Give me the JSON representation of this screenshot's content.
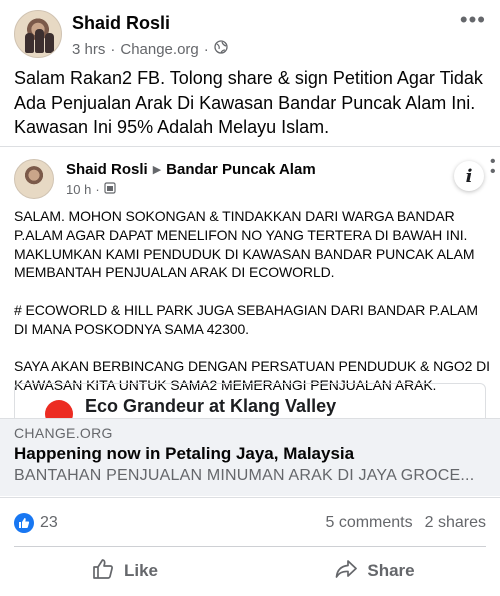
{
  "post": {
    "author": "Shaid Rosli",
    "time": "3 hrs",
    "source": "Change.org",
    "text": "Salam Rakan2 FB. Tolong share & sign Petition Agar Tidak Ada Penjualan Arak Di Kawasan Bandar Puncak Alam Ini. Kawasan Ini 95% Adalah Melayu Islam."
  },
  "shared_post": {
    "author": "Shaid Rosli",
    "target": "Bandar Puncak Alam",
    "time": "10 h",
    "paragraphs": [
      "SALAM. MOHON SOKONGAN & TINDAKKAN DARI WARGA BANDAR P.ALAM AGAR DAPAT MENELIFON NO YANG TERTERA DI BAWAH INI. MAKLUMKAN KAMI PENDUDUK DI KAWASAN BANDAR PUNCAK ALAM MEMBANTAH PENJUALAN ARAK DI ECOWORLD.",
      "# ECOWORLD & HILL PARK JUGA SEBAHAGIAN DARI BANDAR P.ALAM DI MANA POSKODNYA SAMA 42300.",
      "SAYA AKAN BERBINCANG DENGAN PERSATUAN PENDUDUK & NGO2 DI KAWASAN KITA UNTUK SAMA2 MEMERANGI PENJUALAN ARAK."
    ],
    "peek_title": "Eco Grandeur at Klang Valley"
  },
  "link_preview": {
    "domain": "CHANGE.ORG",
    "title": "Happening now in Petaling Jaya, Malaysia",
    "description": "BANTAHAN PENJUALAN MINUMAN ARAK DI JAYA GROCE..."
  },
  "stats": {
    "likes": "23",
    "comments": "5 comments",
    "shares": "2 shares"
  },
  "actions": {
    "like": "Like",
    "share": "Share"
  },
  "colors": {
    "brand_blue": "#1877f2",
    "secondary_text": "#65676b"
  }
}
